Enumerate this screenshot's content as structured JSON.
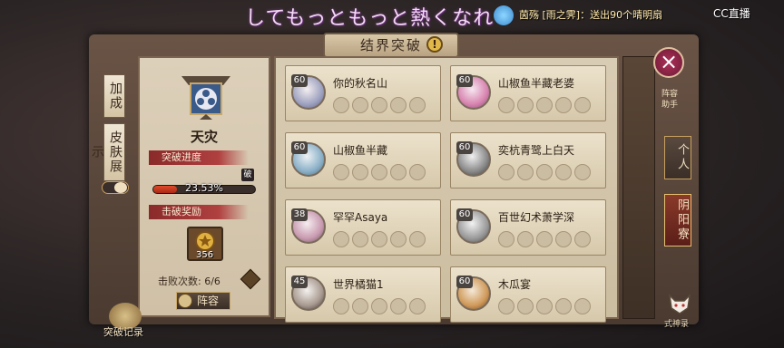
{
  "overlay": {
    "danmaku": "してもっともっと熱くなれ",
    "gift_message": "茵殇 [雨之霁]：送出90个晴明扇",
    "platform": "CC直播"
  },
  "title": "结界突破",
  "left_tabs": [
    "加成",
    "皮肤展示"
  ],
  "guild": {
    "name": "天灾",
    "progress_label": "突破进度",
    "progress_text": "23.53%",
    "progress_value": 0.2353,
    "badge": "破",
    "reward_label": "击破奖励",
    "reward_count": "356",
    "defeat_label": "击败次数: 6/6",
    "lineup_button": "阵容"
  },
  "cards": [
    {
      "level": "60",
      "name": "你的秋名山"
    },
    {
      "level": "60",
      "name": "山椒鱼半藏老婆"
    },
    {
      "level": "60",
      "name": "山椒鱼半藏"
    },
    {
      "level": "60",
      "name": "奕杭青鹭上白天"
    },
    {
      "level": "38",
      "name": "罕罕Asaya"
    },
    {
      "level": "60",
      "name": "百世幻术萧学深"
    },
    {
      "level": "45",
      "name": "世界橘猫1"
    },
    {
      "level": "60",
      "name": "木瓜宴"
    }
  ],
  "right": {
    "assist_label": "阵容助手",
    "tab_personal": "个人",
    "tab_yinyangliao": "阴阳寮",
    "shikigami_record": "式神录"
  },
  "bottom": {
    "record_label": "突破记录"
  },
  "colors": {
    "accent_red": "#b04040",
    "close_button": "#b0305a",
    "parchment": "#ddd0ba"
  }
}
